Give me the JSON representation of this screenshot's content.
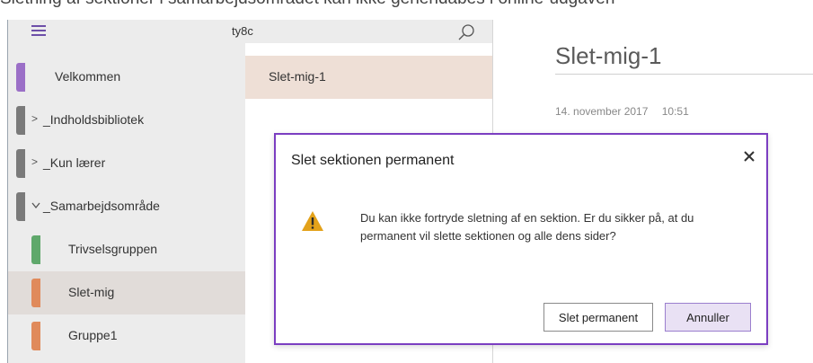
{
  "banner": {
    "text": "Sletning af sektioner i samarbejdsområdet kan ikke genendabes i online-udgaven"
  },
  "header": {
    "menu_icon": "hamburger-icon",
    "notebook_name": "ty8c",
    "search_icon": "search-icon",
    "accent": "#6d4fa8"
  },
  "sidebar": {
    "items": [
      {
        "label": "Velkommen",
        "color": "#9b6fc7",
        "expand": ""
      },
      {
        "label": "_Indholdsbibliotek",
        "color": "#7a7a7a",
        "expand": ">"
      },
      {
        "label": "_Kun lærer",
        "color": "#7a7a7a",
        "expand": ">"
      },
      {
        "label": "_Samarbejdsområde",
        "color": "#7a7a7a",
        "expand": "v"
      },
      {
        "label": "Trivselsgruppen",
        "color": "#5fa86b",
        "expand": ""
      },
      {
        "label": "Slet-mig",
        "color": "#e08a5b",
        "expand": ""
      },
      {
        "label": "Gruppe1",
        "color": "#e08a5b",
        "expand": ""
      }
    ]
  },
  "pages": {
    "items": [
      {
        "label": "Slet-mig-1"
      }
    ]
  },
  "page": {
    "title": "Slet-mig-1",
    "date": "14. november 2017",
    "time": "10:51"
  },
  "dialog": {
    "title": "Slet sektionen permanent",
    "close_icon": "close-icon",
    "warning_icon": "warning-icon",
    "message": "Du kan ikke fortryde sletning af en sektion. Er du sikker på, at du permanent vil slette sektionen og alle dens sider?",
    "confirm_label": "Slet permanent",
    "cancel_label": "Annuller",
    "border_color": "#7b3ec1",
    "warning_color": "#e3a21a"
  }
}
